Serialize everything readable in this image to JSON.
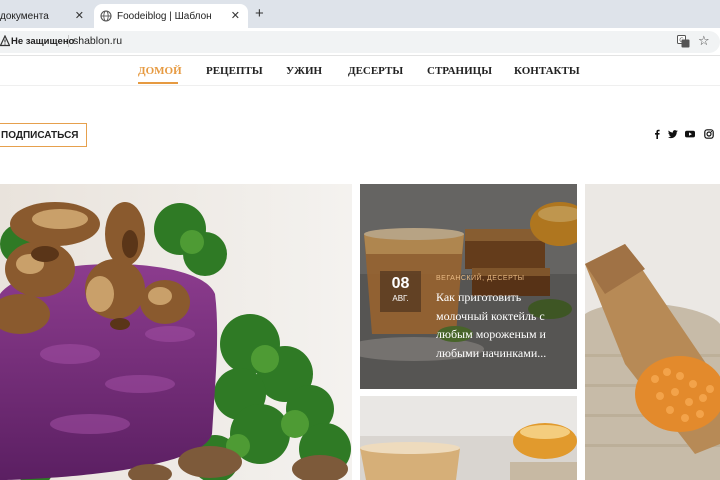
{
  "browser": {
    "tabs": [
      {
        "title": "документа"
      },
      {
        "title": "Foodeiblog | Шаблон"
      }
    ],
    "close_glyph": "✕",
    "new_tab_glyph": "+",
    "security_label": "Не защищено",
    "url": "shablon.ru",
    "icons": [
      "globe-icon",
      "lock-icon",
      "translate-icon",
      "star-icon",
      "close-icon",
      "plus-icon"
    ]
  },
  "nav": {
    "items": [
      "ДОМОЙ",
      "РЕЦЕПТЫ",
      "УЖИН",
      "ДЕСЕРТЫ",
      "СТРАНИЦЫ",
      "КОНТАКТЫ"
    ],
    "active_color": "#e69a41"
  },
  "header": {
    "subscribe_label": "ПОДПИСАТЬСЯ",
    "social_icons": [
      "facebook-icon",
      "twitter-icon",
      "youtube-icon",
      "instagram-icon"
    ]
  },
  "featured": {
    "card": {
      "date_day": "08",
      "date_month": "АВГ.",
      "categories": "ВЕГАНСКИЙ, ДЕСЕРТЫ",
      "title": "Как приготовить молочный коктейль с любым мороженым и любыми начинками..."
    }
  },
  "colors": {
    "accent": "#e69a41",
    "tabbar": "#dee3ea"
  }
}
